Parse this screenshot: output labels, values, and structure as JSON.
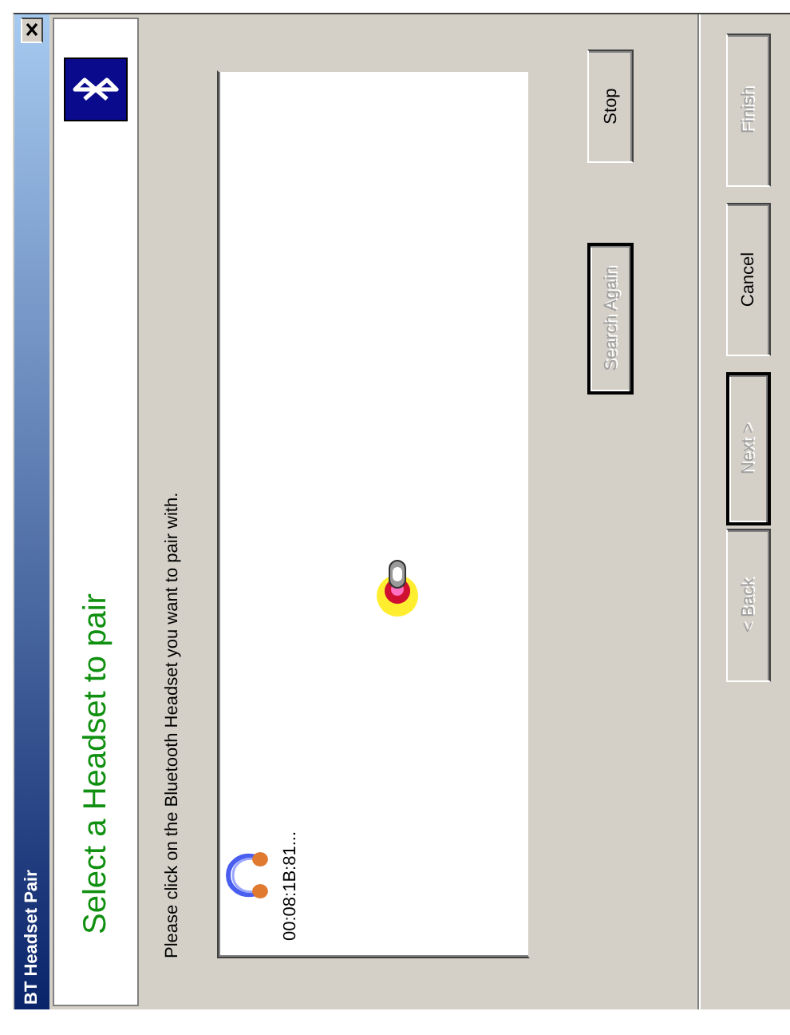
{
  "window": {
    "title": "BT Headset Pair"
  },
  "header": {
    "title": "Select a Headset to pair"
  },
  "instruction": "Please click on the Bluetooth Headset you want to pair with.",
  "devices": [
    {
      "kind": "headset",
      "label": "00:08:1B:81..."
    },
    {
      "kind": "searching"
    }
  ],
  "search_buttons": [
    {
      "label": "Search Again",
      "disabled": true,
      "default": true
    },
    {
      "label": "Stop",
      "disabled": false,
      "default": false
    }
  ],
  "nav_buttons": [
    {
      "label": "< Back",
      "disabled": true,
      "default": false
    },
    {
      "label": "Next >",
      "disabled": true,
      "default": true
    },
    {
      "label": "Cancel",
      "disabled": false,
      "default": false
    },
    {
      "label": "Finish",
      "disabled": true,
      "default": false
    }
  ]
}
